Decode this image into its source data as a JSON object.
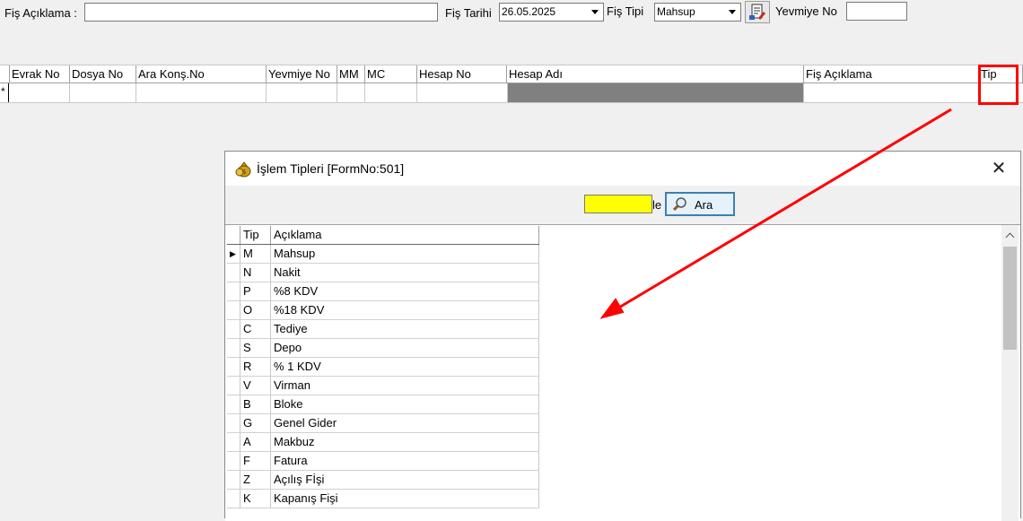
{
  "header": {
    "fis_aciklama_label": "Fiş Açıklama :",
    "fis_aciklama_value": "",
    "fis_tarihi_label": "Fiş Tarihi",
    "fis_tarihi_value": "26.05.2025",
    "fis_tipi_label": "Fiş  Tipi",
    "fis_tipi_value": "Mahsup",
    "yevmiye_no_label": "Yevmiye No",
    "yevmiye_no_value": ""
  },
  "grid": {
    "columns": [
      "Evrak No",
      "Dosya No",
      "Ara Konş.No",
      "Yevmiye No",
      "MM",
      "MC",
      "Hesap No",
      "Hesap Adı",
      "Fiş Açıklama",
      "Tip"
    ],
    "new_row_marker": "*"
  },
  "dialog": {
    "title": "İşlem Tipleri [FormNo:501]",
    "close_glyph": "✕",
    "search_value": "",
    "search_trailing_text": "le",
    "ara_label": "Ara",
    "columns": [
      "Tip",
      "Açıklama"
    ],
    "row_pointer": "▶",
    "rows": [
      {
        "tip": "M",
        "aciklama": "Mahsup"
      },
      {
        "tip": "N",
        "aciklama": "Nakit"
      },
      {
        "tip": "P",
        "aciklama": "%8 KDV"
      },
      {
        "tip": "O",
        "aciklama": "%18 KDV"
      },
      {
        "tip": "C",
        "aciklama": "Tediye"
      },
      {
        "tip": "S",
        "aciklama": "Depo"
      },
      {
        "tip": "R",
        "aciklama": "% 1 KDV"
      },
      {
        "tip": "V",
        "aciklama": "Virman"
      },
      {
        "tip": "B",
        "aciklama": "Bloke"
      },
      {
        "tip": "G",
        "aciklama": "Genel Gider"
      },
      {
        "tip": "A",
        "aciklama": "Makbuz"
      },
      {
        "tip": "F",
        "aciklama": "Fatura"
      },
      {
        "tip": "Z",
        "aciklama": "Açılış Fİşi"
      },
      {
        "tip": "K",
        "aciklama": "Kapanış Fişi"
      }
    ]
  },
  "annotation": {
    "highlight_color": "#ff0000",
    "arrow_color": "#ff0000"
  },
  "icons": [
    "dropdown-arrow-icon",
    "document-edit-icon",
    "money-bag-icon",
    "close-icon",
    "magnifier-icon",
    "scroll-up-icon",
    "row-pointer-icon"
  ]
}
